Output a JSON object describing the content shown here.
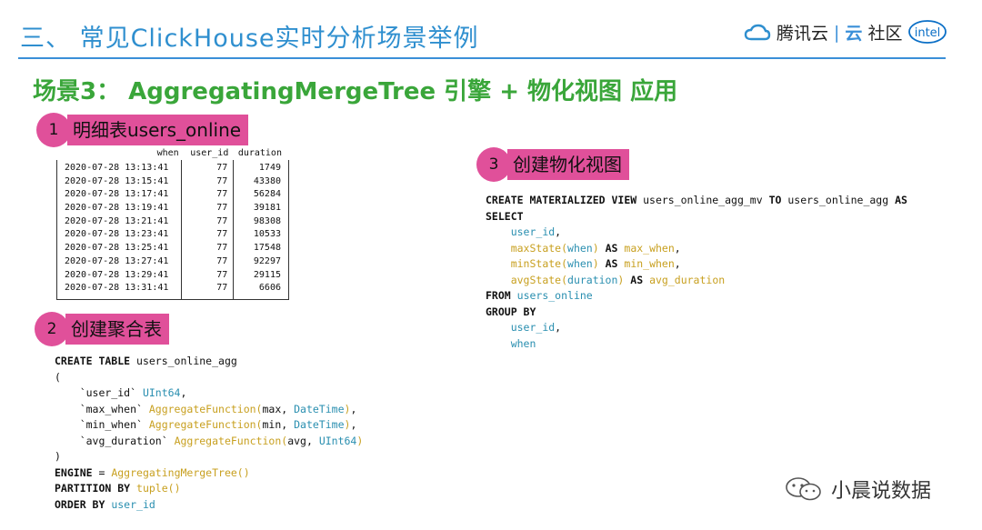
{
  "header": {
    "title": "三、 常见ClickHouse实时分析场景举例",
    "brand_tencent": "腾讯云",
    "brand_sep": "|",
    "brand_yun": "云",
    "brand_community": "社区",
    "intel": "intel"
  },
  "scene_title": "场景3： AggregatingMergeTree 引擎 + 物化视图 应用",
  "section1": {
    "num": "1",
    "label": "明细表users_online",
    "columns": [
      "when",
      "user_id",
      "duration"
    ],
    "rows": [
      [
        "2020-07-28 13:13:41",
        "77",
        "1749"
      ],
      [
        "2020-07-28 13:15:41",
        "77",
        "43380"
      ],
      [
        "2020-07-28 13:17:41",
        "77",
        "56284"
      ],
      [
        "2020-07-28 13:19:41",
        "77",
        "39181"
      ],
      [
        "2020-07-28 13:21:41",
        "77",
        "98308"
      ],
      [
        "2020-07-28 13:23:41",
        "77",
        "10533"
      ],
      [
        "2020-07-28 13:25:41",
        "77",
        "17548"
      ],
      [
        "2020-07-28 13:27:41",
        "77",
        "92297"
      ],
      [
        "2020-07-28 13:29:41",
        "77",
        "29115"
      ],
      [
        "2020-07-28 13:31:41",
        "77",
        "6606"
      ]
    ]
  },
  "section2": {
    "num": "2",
    "label": "创建聚合表",
    "code": [
      [
        [
          "kw",
          "CREATE TABLE"
        ],
        [
          "t",
          " users_online_agg"
        ]
      ],
      [
        [
          "t",
          "("
        ]
      ],
      [
        [
          "t",
          "    `user_id` "
        ],
        [
          "ty",
          "UInt64"
        ],
        [
          "t",
          ","
        ]
      ],
      [
        [
          "t",
          "    `max_when` "
        ],
        [
          "fn",
          "AggregateFunction("
        ],
        [
          "t",
          "max, "
        ],
        [
          "ty",
          "DateTime"
        ],
        [
          "fn",
          ")"
        ],
        [
          "t",
          ","
        ]
      ],
      [
        [
          "t",
          "    `min_when` "
        ],
        [
          "fn",
          "AggregateFunction("
        ],
        [
          "t",
          "min, "
        ],
        [
          "ty",
          "DateTime"
        ],
        [
          "fn",
          ")"
        ],
        [
          "t",
          ","
        ]
      ],
      [
        [
          "t",
          "    `avg_duration` "
        ],
        [
          "fn",
          "AggregateFunction("
        ],
        [
          "t",
          "avg, "
        ],
        [
          "ty",
          "UInt64"
        ],
        [
          "fn",
          ")"
        ]
      ],
      [
        [
          "t",
          ")"
        ]
      ],
      [
        [
          "kw",
          "ENGINE"
        ],
        [
          "t",
          " = "
        ],
        [
          "fn",
          "AggregatingMergeTree()"
        ]
      ],
      [
        [
          "kw",
          "PARTITION BY"
        ],
        [
          "t",
          " "
        ],
        [
          "fn",
          "tuple()"
        ]
      ],
      [
        [
          "kw",
          "ORDER BY"
        ],
        [
          "t",
          " "
        ],
        [
          "id",
          "user_id"
        ]
      ]
    ]
  },
  "section3": {
    "num": "3",
    "label": "创建物化视图",
    "code": [
      [
        [
          "kw",
          "CREATE MATERIALIZED VIEW"
        ],
        [
          "t",
          " users_online_agg_mv "
        ],
        [
          "kw",
          "TO"
        ],
        [
          "t",
          " users_online_agg "
        ],
        [
          "kw",
          "AS"
        ]
      ],
      [
        [
          "kw",
          "SELECT"
        ]
      ],
      [
        [
          "t",
          "    "
        ],
        [
          "id",
          "user_id"
        ],
        [
          "t",
          ","
        ]
      ],
      [
        [
          "t",
          "    "
        ],
        [
          "fn",
          "maxState("
        ],
        [
          "id",
          "when"
        ],
        [
          "fn",
          ")"
        ],
        [
          "t",
          " "
        ],
        [
          "kw",
          "AS"
        ],
        [
          "t",
          " "
        ],
        [
          "fn",
          "max_when"
        ],
        [
          "t",
          ","
        ]
      ],
      [
        [
          "t",
          "    "
        ],
        [
          "fn",
          "minState("
        ],
        [
          "id",
          "when"
        ],
        [
          "fn",
          ")"
        ],
        [
          "t",
          " "
        ],
        [
          "kw",
          "AS"
        ],
        [
          "t",
          " "
        ],
        [
          "fn",
          "min_when"
        ],
        [
          "t",
          ","
        ]
      ],
      [
        [
          "t",
          "    "
        ],
        [
          "fn",
          "avgState("
        ],
        [
          "id",
          "duration"
        ],
        [
          "fn",
          ")"
        ],
        [
          "t",
          " "
        ],
        [
          "kw",
          "AS"
        ],
        [
          "t",
          " "
        ],
        [
          "fn",
          "avg_duration"
        ]
      ],
      [
        [
          "kw",
          "FROM"
        ],
        [
          "t",
          " "
        ],
        [
          "id",
          "users_online"
        ]
      ],
      [
        [
          "kw",
          "GROUP BY"
        ]
      ],
      [
        [
          "t",
          "    "
        ],
        [
          "id",
          "user_id"
        ],
        [
          "t",
          ","
        ]
      ],
      [
        [
          "t",
          "    "
        ],
        [
          "id",
          "when"
        ]
      ]
    ]
  },
  "watermark": "小晨说数据",
  "colors": {
    "title_blue": "#2f8fcf",
    "scene_green": "#3aa63a",
    "badge_pink": "#e0509a",
    "func_gold": "#c8a020",
    "ident_teal": "#2a8fb0"
  }
}
